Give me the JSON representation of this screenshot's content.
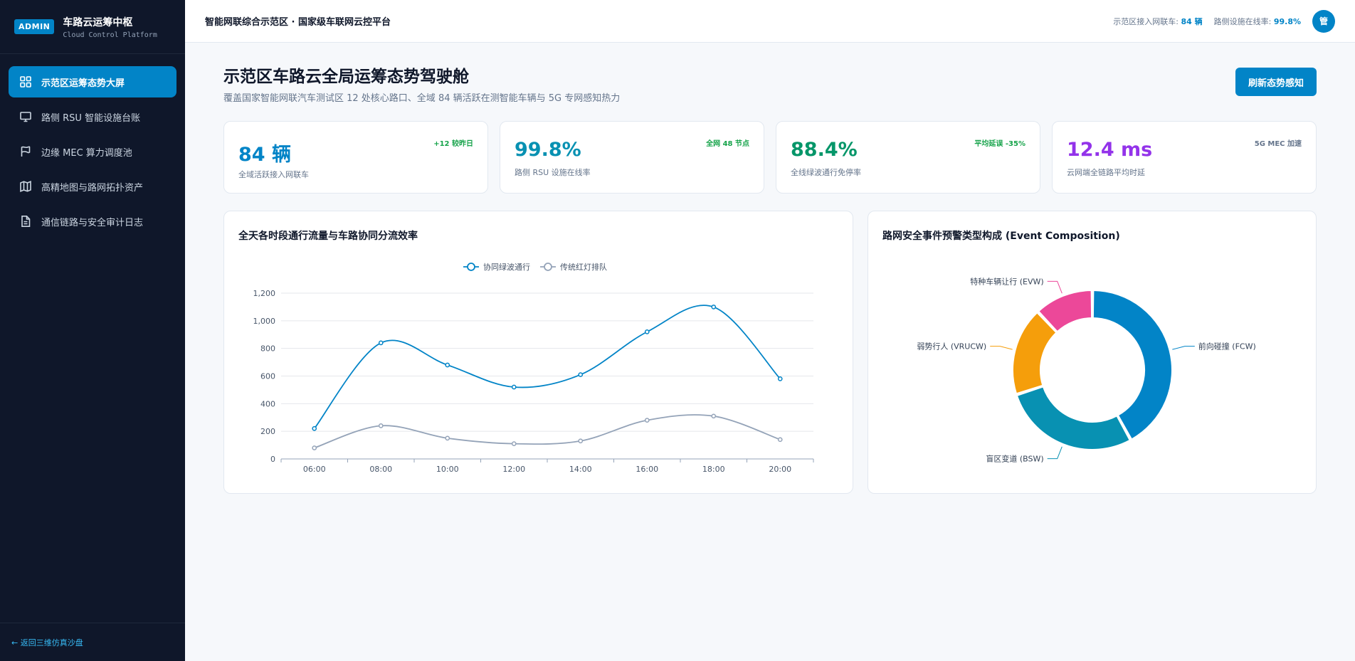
{
  "brand": {
    "badge": "ADMIN",
    "title": "车路云运筹中枢",
    "subtitle": "Cloud Control Platform"
  },
  "sidebar": {
    "items": [
      {
        "label": "示范区运筹态势大屏",
        "icon": "grid-icon",
        "active": true
      },
      {
        "label": "路侧 RSU 智能设施台账",
        "icon": "monitor-icon",
        "active": false
      },
      {
        "label": "边缘 MEC 算力调度池",
        "icon": "flag-icon",
        "active": false
      },
      {
        "label": "高精地图与路网拓扑资产",
        "icon": "map-icon",
        "active": false
      },
      {
        "label": "通信链路与安全审计日志",
        "icon": "document-icon",
        "active": false
      }
    ],
    "footer": "← 返回三维仿真沙盘"
  },
  "topbar": {
    "title": "智能网联综合示范区 · 国家级车联网云控平台",
    "vehicles_label": "示范区接入网联车:",
    "vehicles_value": "84 辆",
    "online_label": "路侧设施在线率:",
    "online_value": "99.8%",
    "avatar": "管"
  },
  "page": {
    "title": "示范区车路云全局运筹态势驾驶舱",
    "subtitle": "覆盖国家智能网联汽车测试区 12 处核心路口、全域 84 辆活跃在测智能车辆与 5G 专网感知热力",
    "refresh_label": "刷新态势感知"
  },
  "kpis": [
    {
      "value": "84 辆",
      "label": "全域活跃接入网联车",
      "tag": "+12 较昨日",
      "color": "#0284c7",
      "tag_color": "#16a34a"
    },
    {
      "value": "99.8%",
      "label": "路侧 RSU 设施在线率",
      "tag": "全网 48 节点",
      "color": "#0891b2",
      "tag_color": "#16a34a"
    },
    {
      "value": "88.4%",
      "label": "全线绿波通行免停率",
      "tag": "平均延误 -35%",
      "color": "#059669",
      "tag_color": "#16a34a"
    },
    {
      "value": "12.4 ms",
      "label": "云网端全链路平均时延",
      "tag": "5G MEC 加速",
      "color": "#9333ea",
      "tag_color": "#64748b"
    }
  ],
  "charts": {
    "line_title": "全天各时段通行流量与车路协同分流效率",
    "pie_title": "路网安全事件预警类型构成 (Event Composition)"
  },
  "chart_data": [
    {
      "type": "line",
      "categories": [
        "06:00",
        "08:00",
        "10:00",
        "12:00",
        "14:00",
        "16:00",
        "18:00",
        "20:00"
      ],
      "series": [
        {
          "name": "协同绿波通行",
          "values": [
            220,
            840,
            680,
            520,
            610,
            920,
            1100,
            580
          ],
          "color": "#0284c7"
        },
        {
          "name": "传统红灯排队",
          "values": [
            80,
            240,
            150,
            110,
            130,
            280,
            310,
            140
          ],
          "color": "#94a3b8"
        }
      ],
      "ylim": [
        0,
        1200
      ],
      "yticks": [
        "0",
        "200",
        "400",
        "600",
        "800",
        "1,000",
        "1,200"
      ],
      "ytick_values": [
        0,
        200,
        400,
        600,
        800,
        1000,
        1200
      ],
      "grid": true,
      "legend": "top-center"
    },
    {
      "type": "pie",
      "donut": true,
      "slices": [
        {
          "label": "前向碰撞 (FCW)",
          "value": 42,
          "color": "#0284c7"
        },
        {
          "label": "盲区变道 (BSW)",
          "value": 28,
          "color": "#0891b2"
        },
        {
          "label": "弱势行人 (VRUCW)",
          "value": 18,
          "color": "#f59e0b"
        },
        {
          "label": "特种车辆让行 (EVW)",
          "value": 12,
          "color": "#ec4899"
        }
      ]
    }
  ]
}
